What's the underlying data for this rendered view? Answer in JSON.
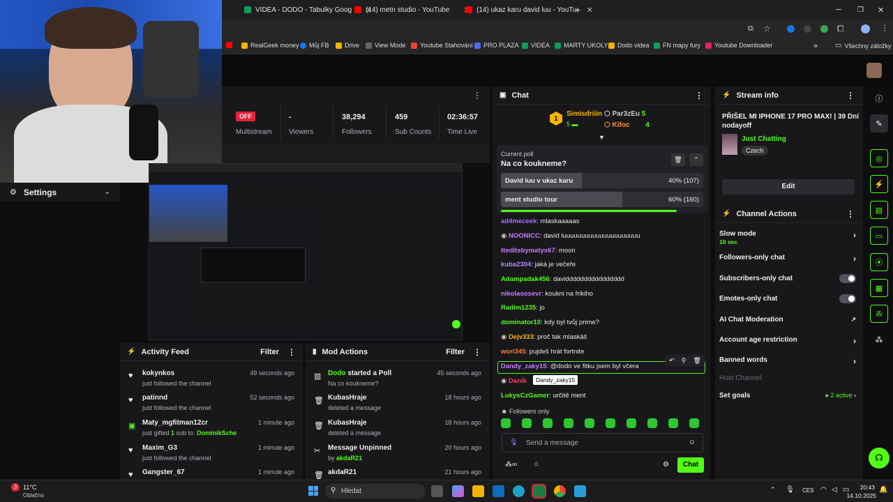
{
  "browser": {
    "tabs": [
      {
        "label": "VIDEA - DODO - Tabulky Goog",
        "color": "#0f9d58"
      },
      {
        "label": "(14) metn studio - YouTube",
        "color": "#ff0000"
      },
      {
        "label": "(14) ukaz karu david luu - YouTu",
        "color": "#ff0000"
      }
    ],
    "new_tab": "+",
    "bookmarks": [
      {
        "label": "RealGeek money",
        "color": "#f4b400"
      },
      {
        "label": "Můj FB",
        "color": "#1877f2"
      },
      {
        "label": "Drive",
        "color": "#f4b400"
      },
      {
        "label": "View Mode",
        "color": "#666"
      },
      {
        "label": "Youtube Stahování",
        "color": "#ea4335"
      },
      {
        "label": "PRO PLAZA",
        "color": "#4a6cf7"
      },
      {
        "label": "VIDEA",
        "color": "#0f9d58"
      },
      {
        "label": "MARTY UKOLY",
        "color": "#0f9d58"
      },
      {
        "label": "Dodo videa",
        "color": "#f4b400"
      },
      {
        "label": "FN mapy fury",
        "color": "#0f9d58"
      },
      {
        "label": "Youtube Downloader",
        "color": "#e91e63"
      }
    ],
    "bookmarks_more": "»",
    "all_bookmarks": "Všechny záložky"
  },
  "stats": [
    {
      "value": "OFF",
      "label": "Multistream"
    },
    {
      "value": "-",
      "label": "Viewers"
    },
    {
      "value": "38,294",
      "label": "Followers"
    },
    {
      "value": "459",
      "label": "Sub Counts"
    },
    {
      "value": "02:36:57",
      "label": "Time Live"
    }
  ],
  "settings": {
    "label": "Settings"
  },
  "activity": {
    "title": "Activity Feed",
    "filter": "Filter",
    "items": [
      {
        "name": "kokynkos",
        "desc": "just followed the channel",
        "time": "49 seconds ago",
        "icon": "♥"
      },
      {
        "name": "patinnd",
        "desc": "just followed the channel",
        "time": "52 seconds ago",
        "icon": "♥"
      },
      {
        "name": "Maty_mgfitman12cr",
        "desc_pre": "just gifted ",
        "desc_num": "1",
        "desc_mid": " sub to: ",
        "desc_user": "DominikSche",
        "time": "1 minute ago",
        "icon": "▣"
      },
      {
        "name": "Maxim_G3",
        "desc": "just followed the channel",
        "time": "1 minute ago",
        "icon": "♥"
      },
      {
        "name": "Gangster_67",
        "desc": "",
        "time": "1 minute ago",
        "icon": "♥"
      }
    ]
  },
  "mod": {
    "title": "Mod Actions",
    "filter": "Filter",
    "items": [
      {
        "name": "Dodo",
        "name_suffix": " started a Poll",
        "desc": "Na co koukneme?",
        "time": "45 seconds ago",
        "icon": "▥"
      },
      {
        "name": "KubasHraje",
        "desc": "deleted a message",
        "time": "18 hours ago",
        "icon": "🗑"
      },
      {
        "name": "KubasHraje",
        "desc": "deleted a message",
        "time": "18 hours ago",
        "icon": "🗑"
      },
      {
        "name": "Message Unpinned",
        "desc_pre": "by ",
        "desc_user": "akdaR21",
        "time": "20 hours ago",
        "icon": "✂"
      },
      {
        "name": "akdaR21",
        "desc": "",
        "time": "21 hours ago",
        "icon": "🗑"
      }
    ]
  },
  "chat": {
    "title": "Chat",
    "top_gifters": [
      {
        "name": "Simisdriiin",
        "count": "5"
      },
      {
        "name": "Par3zEu",
        "count": "5"
      },
      {
        "name": "Kifoc",
        "count": "4"
      }
    ],
    "poll": {
      "label": "Current poll",
      "question": "Na co koukneme?",
      "options": [
        {
          "label": "David luu v ukaz karu",
          "result": "40% (107)",
          "percent": 40
        },
        {
          "label": "ment studio tour",
          "result": "60% (160)",
          "percent": 60
        }
      ]
    },
    "messages": [
      {
        "user": "ad4meceek",
        "text": ": mlaskaaaaas",
        "color": "#a970ff"
      },
      {
        "user": "NOONICC",
        "text": ": david luuuuuuuuuuuuuuuuuuuuu",
        "color": "#c77dff",
        "badge": true
      },
      {
        "user": "tteditsbymatyx67",
        "text": ": moon",
        "color": "#c77dff"
      },
      {
        "user": "kuba2304",
        "text": ": jaká je večeře",
        "color": "#b48cff"
      },
      {
        "user": "Adampadak456",
        "text": ": davidddddddddddddddd",
        "color": "#53fc18"
      },
      {
        "user": "nikolasosevr",
        "text": ": koukni na frikiho",
        "color": "#c77dff"
      },
      {
        "user": "Radim1235",
        "text": ": jo",
        "color": "#53fc18"
      },
      {
        "user": "dominator10",
        "text": ": kdy byl tvůj prime?",
        "color": "#53fc18"
      },
      {
        "user": "Dejv333",
        "text": ": proč tak mlaskáš",
        "color": "#ffb020",
        "badge": true
      },
      {
        "user": "wori345",
        "text": ": pujdeš hrát fortnite",
        "color": "#ff7b39"
      },
      {
        "user": "Dandy_zaky15",
        "text": ": @dodo ve fitku jsem byl včera",
        "color": "#c77dff"
      },
      {
        "user": "Danik",
        "text": "",
        "color": "#ff3d57",
        "badge": true
      },
      {
        "user": "LukysCzGamer",
        "text": ": určitě ment",
        "color": "#53fc18"
      }
    ],
    "tooltip": "Dandy_zaky15",
    "followers_only": "Followers only",
    "input_placeholder": "Send a message",
    "send": "Chat",
    "emotes_count": 10
  },
  "stream_info": {
    "title": "Stream info",
    "stream_title": "PŘIŠEL MI IPHONE 17 PRO MAX! | 39 Dní nodayoff",
    "category": "Just Chatting",
    "language": "Czech",
    "edit": "Edit"
  },
  "channel_actions": {
    "title": "Channel Actions",
    "slow_mode": "Slow mode",
    "slow_mode_value": "10 sec",
    "followers_only": "Followers-only chat",
    "subscribers_only": "Subscribers-only chat",
    "emotes_only": "Emotes-only chat",
    "ai_moderation": "AI Chat Moderation",
    "account_age": "Account age restriction",
    "banned_words": "Banned words",
    "host_channel": "Host Channel",
    "set_goals": "Set goals",
    "goals_active": "2 active"
  },
  "taskbar": {
    "weather_temp": "11°C",
    "weather_desc": "Oblačno",
    "weather_badge": "3",
    "search": "Hledat",
    "lang": "CES",
    "time": "20:43",
    "date": "14.10.2025"
  },
  "colors": {
    "kick_green": "#53fc18",
    "panel": "#18181b",
    "bg": "#0e0e10"
  }
}
